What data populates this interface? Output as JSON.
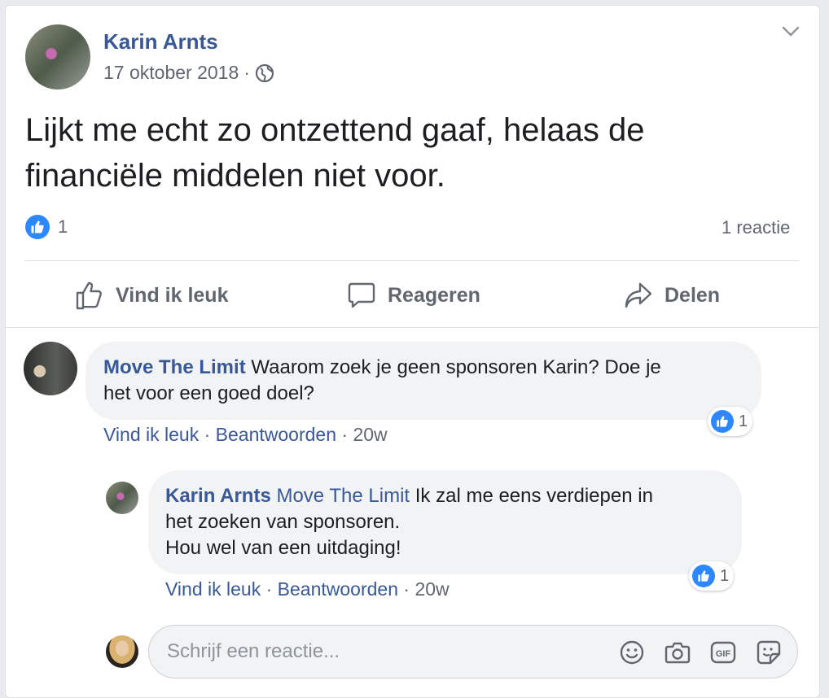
{
  "post": {
    "author": "Karin Arnts",
    "date": "17 oktober 2018",
    "separator": "·",
    "text_line1": "Lijkt me echt zo ontzettend gaaf, helaas de",
    "text_line2": "financiële middelen niet voor.",
    "like_count": "1",
    "comment_count": "1 reactie"
  },
  "actions": {
    "like": "Vind ik leuk",
    "comment": "Reageren",
    "share": "Delen"
  },
  "comments": [
    {
      "author": "Move The Limit",
      "text_line1": " Waarom zoek je geen sponsoren Karin? Doe je",
      "text_line2": "het voor een goed doel?",
      "like_link": "Vind ik leuk",
      "dot1": " · ",
      "reply_link": "Beantwoorden",
      "dot2": " · ",
      "time": "20w",
      "reactions": "1"
    }
  ],
  "reply": {
    "author": "Karin Arnts",
    "mention": " Move The Limit",
    "text_line1": " Ik zal me eens verdiepen in",
    "text_line2": "het zoeken van sponsoren.",
    "text_line3": "Hou wel van een uitdaging!",
    "like_link": "Vind ik leuk",
    "dot1": " · ",
    "reply_link": "Beantwoorden",
    "dot2": " · ",
    "time": "20w",
    "reactions": "1"
  },
  "composer": {
    "placeholder": "Schrijf een reactie..."
  },
  "icons": {
    "menu": "chevron-down-icon",
    "privacy": "globe-icon",
    "like": "thumbs-up-icon",
    "comment": "speech-bubble-icon",
    "share": "share-arrow-icon",
    "emoji": "smiley-icon",
    "photo": "camera-icon",
    "gif": "gif-icon",
    "sticker": "sticker-icon"
  },
  "colors": {
    "link": "#385898",
    "like_blue": "#2d88ff",
    "muted": "#606770",
    "bubble": "#f2f3f5"
  }
}
